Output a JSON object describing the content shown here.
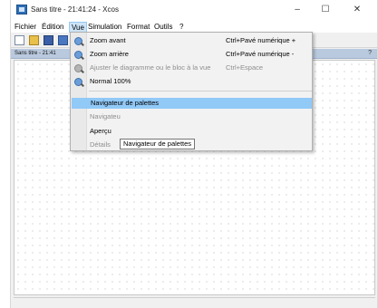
{
  "window": {
    "title": "Sans titre - 21:41:24 - Xcos",
    "minimize": "–",
    "maximize": "☐",
    "close": "✕"
  },
  "menubar": {
    "items": [
      "Fichier",
      "Édition",
      "Vue",
      "Simulation",
      "Format",
      "Outils",
      "?"
    ],
    "active": "Vue"
  },
  "tab": {
    "label": "Sans titre - 21:41",
    "help": "?"
  },
  "view_menu": {
    "items": [
      {
        "label": "Zoom avant",
        "shortcut": "Ctrl+Pavé numérique +",
        "icon": "zoom-in-icon",
        "enabled": true
      },
      {
        "label": "Zoom arrière",
        "shortcut": "Ctrl+Pavé numérique -",
        "icon": "zoom-out-icon",
        "enabled": true
      },
      {
        "label": "Ajuster le diagramme ou le bloc à la vue",
        "shortcut": "Ctrl+Espace",
        "icon": "zoom-fit-icon",
        "enabled": false
      },
      {
        "label": "Normal 100%",
        "shortcut": "",
        "icon": "zoom-normal-icon",
        "enabled": true
      },
      {
        "label": "Navigateur de palettes",
        "shortcut": "",
        "icon": "",
        "enabled": true,
        "highlighted": true
      },
      {
        "label": "Navigateu",
        "shortcut": "",
        "icon": "",
        "enabled": false
      },
      {
        "label": "Aperçu",
        "shortcut": "",
        "icon": "",
        "enabled": true
      },
      {
        "label": "Détails",
        "shortcut": "",
        "icon": "",
        "enabled": false
      }
    ]
  },
  "tooltip": {
    "text": "Navigateur de palettes"
  }
}
